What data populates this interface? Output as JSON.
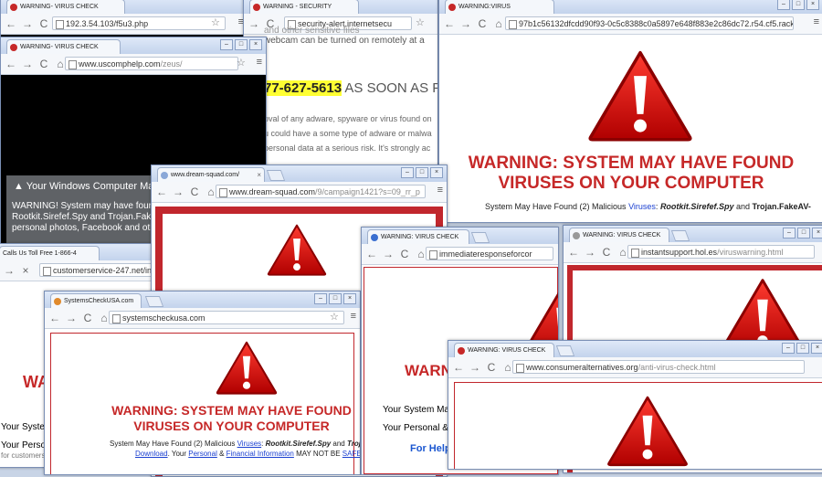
{
  "windows": {
    "w1": {
      "tab": "WARNING- VIRUS CHECK",
      "url": "192.3.54.103/f5u3.php"
    },
    "w2": {
      "tab": "WARNING - SECURITY",
      "url": "security-alert.internetsecu",
      "lines": [
        "and other sensitive files",
        "webcam can be turned on remotely at a"
      ],
      "phone": "77-627-5613",
      "phone_suffix": " AS SOON AS P",
      "para": [
        "oval of any adware, spyware or virus found on",
        "u could have a some type of adware or malwa",
        "personal data at a serious risk. It's strongly ac"
      ]
    },
    "w3": {
      "tab": "WARNING:VIRUS",
      "url": "97b1c56132dfcdd90f93-0c5c8388c0a5897e648f883e2c86dc72.r54.cf5.rackcdn.",
      "heading1": "WARNING: SYSTEM MAY HAVE FOUND",
      "heading2": "VIRUSES ON YOUR COMPUTER",
      "line_a": "System May Have Found (2) Malicious ",
      "viruses": "Viruses",
      "line_b": ": ",
      "v1": "Rootkit.Sirefef.Spy",
      "and": " and ",
      "v2": "Trojan.FakeAV-"
    },
    "w4": {
      "tab": "WARNING- VIRUS CHECK",
      "url": "www.uscomphelp.com",
      "url_path": "/zeus/",
      "box_title": "Your Windows Computer May",
      "box_lines": [
        "WARNING! System may have four",
        "Rootkit.Sirefef.Spy and Trojan.Fake",
        "personal photos, Facebook and oth"
      ]
    },
    "w5": {
      "tab": "www.dream-squad.com/",
      "url": "www.dream-squad.com",
      "url_path": "/9/campaign1421?s=09_rr_p"
    },
    "w6": {
      "tab": "Calls Us Toll Free 1-866-4",
      "url": "customerservice-247.net/inc",
      "heading": "WA",
      "line1": "Your Syste",
      "line2": "Your Persona",
      "footer": "for customerse"
    },
    "w7": {
      "tab": "SystemsCheckUSA.com",
      "url": "systemscheckusa.com",
      "heading1": "WARNING: SYSTEM MAY HAVE FOUND",
      "heading2": "VIRUSES ON YOUR COMPUTER",
      "l1a": "System May Have Found (2) Malicious ",
      "viruses": "Viruses",
      "l1b": ": ",
      "v1": "Rootkit.Sirefef.Spy",
      "and": " and ",
      "v2": "Trojan.F",
      "download": "Download",
      "l2a": ". Your ",
      "personal": "Personal",
      "amp": " & ",
      "financial": "Financial Information",
      "l2b": " MAY NOT BE ",
      "safe": "SAFE"
    },
    "w8": {
      "tab": "WARNING: VIRUS CHECK",
      "url": "immediateresponseforcor",
      "heading": "WARN",
      "line1": "Your System May I",
      "line2": "Your Personal & F",
      "help": "For Help"
    },
    "w9": {
      "tab": "WARNING: VIRUS CHECK",
      "url": "instantsupport.hol.es",
      "url_path": "/viruswarning.html"
    },
    "w10": {
      "tab": "WARNING: VIRUS CHECK",
      "url": "www.consumeralternatives.org",
      "url_path": "/anti-virus-check.html"
    }
  },
  "colors": {
    "warning_red": "#c62828",
    "frame_red": "#c1272d",
    "phone_highlight": "#ffff33",
    "link_blue": "#1a3fd0"
  },
  "icons": {
    "warning": "warning-triangle-icon"
  }
}
